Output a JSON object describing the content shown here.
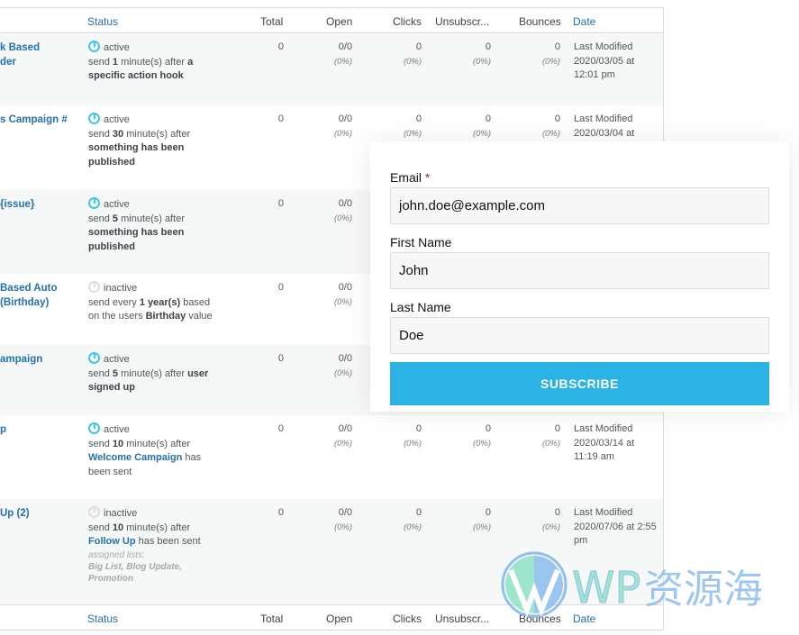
{
  "table": {
    "headers": {
      "status": "Status",
      "total": "Total",
      "open": "Open",
      "clicks": "Clicks",
      "unsub": "Unsubscr...",
      "bounces": "Bounces",
      "date": "Date"
    },
    "rows": [
      {
        "name": "k Based\nder",
        "state": "active",
        "active": true,
        "desc": [
          [
            "send ",
            ""
          ],
          [
            "1",
            "b"
          ],
          [
            " minute(s) after ",
            ""
          ],
          [
            "a specific action hook",
            "b"
          ]
        ],
        "total": "0",
        "open": "0/0",
        "open_pct": "(0%)",
        "clicks": "0",
        "clicks_pct": "(0%)",
        "unsub": "0",
        "unsub_pct": "(0%)",
        "bounces": "0",
        "bounces_pct": "(0%)",
        "date": "Last Modified 2020/03/05 at 12:01 pm"
      },
      {
        "name": "s Campaign #",
        "state": "active",
        "active": true,
        "desc": [
          [
            "send ",
            ""
          ],
          [
            "30",
            "b"
          ],
          [
            " minute(s) after ",
            ""
          ],
          [
            "something has been published",
            "b"
          ]
        ],
        "total": "0",
        "open": "0/0",
        "open_pct": "(0%)",
        "clicks": "0",
        "clicks_pct": "(0%)",
        "unsub": "0",
        "unsub_pct": "(0%)",
        "bounces": "0",
        "bounces_pct": "(0%)",
        "date": "Last Modified 2020/03/04 at"
      },
      {
        "name": "{issue}",
        "state": "active",
        "active": true,
        "desc": [
          [
            "send ",
            ""
          ],
          [
            "5",
            "b"
          ],
          [
            " minute(s) after ",
            ""
          ],
          [
            "something has been published",
            "b"
          ]
        ],
        "total": "0",
        "open": "0/0",
        "open_pct": "(0%)"
      },
      {
        "name": "Based Auto\n(Birthday)",
        "state": "inactive",
        "active": false,
        "desc": [
          [
            "send every ",
            ""
          ],
          [
            "1 year(s)",
            "b"
          ],
          [
            " based on the users ",
            ""
          ],
          [
            "Birthday",
            "b"
          ],
          [
            " value",
            ""
          ]
        ],
        "total": "0",
        "open": "0/0",
        "open_pct": "(0%)"
      },
      {
        "name": "ampaign",
        "state": "active",
        "active": true,
        "desc": [
          [
            "send ",
            ""
          ],
          [
            "5",
            "b"
          ],
          [
            " minute(s) after ",
            ""
          ],
          [
            "user signed up",
            "b"
          ]
        ],
        "total": "0",
        "open": "0/0",
        "open_pct": "(0%)"
      },
      {
        "name": "p",
        "state": "active",
        "active": true,
        "desc": [
          [
            "send ",
            ""
          ],
          [
            "10",
            "b"
          ],
          [
            " minute(s) after ",
            ""
          ],
          [
            "Welcome Campaign",
            "l"
          ],
          [
            " has been sent",
            ""
          ]
        ],
        "total": "0",
        "open": "0/0",
        "open_pct": "(0%)",
        "clicks": "0",
        "clicks_pct": "(0%)",
        "unsub": "0",
        "unsub_pct": "(0%)",
        "bounces": "0",
        "bounces_pct": "(0%)",
        "date": "Last Modified 2020/03/14 at 11:19 am"
      },
      {
        "name": "Up (2)",
        "state": "inactive",
        "active": false,
        "desc": [
          [
            "send ",
            ""
          ],
          [
            "10",
            "b"
          ],
          [
            " minute(s) after ",
            ""
          ],
          [
            "Follow Up",
            "l"
          ],
          [
            " has been sent",
            ""
          ]
        ],
        "lists_label": "assigned lists:",
        "lists": "Big List, Blog Update, Promotion",
        "total": "0",
        "open": "0/0",
        "open_pct": "(0%)",
        "clicks": "0",
        "clicks_pct": "(0%)",
        "unsub": "0",
        "unsub_pct": "(0%)",
        "bounces": "0",
        "bounces_pct": "(0%)",
        "date": "Last Modified 2020/07/06 at 2:55 pm"
      }
    ]
  },
  "form": {
    "email_label": "Email",
    "required_mark": "*",
    "email_value": "john.doe@example.com",
    "first_label": "First Name",
    "first_value": "John",
    "last_label": "Last Name",
    "last_value": "Doe",
    "submit": "SUBSCRIBE",
    "accent": "#2bb3e6"
  },
  "watermark": {
    "text": "WP资源海"
  }
}
